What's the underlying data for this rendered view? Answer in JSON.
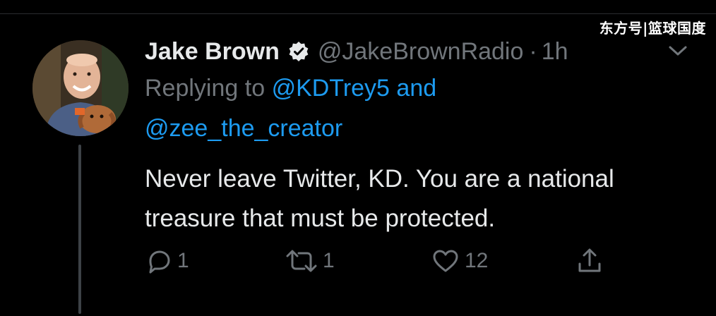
{
  "watermark": "东方号|篮球国度",
  "tweet": {
    "author_name": "Jake Brown",
    "author_handle": "@JakeBrownRadio",
    "separator": "·",
    "time": "1h",
    "replying_prefix": "Replying to",
    "replying_mention_1": "@KDTrey5",
    "replying_and": "and",
    "replying_mention_2": "@zee_the_creator",
    "text": "Never leave Twitter, KD. You are a national treasure that must be protected."
  },
  "actions": {
    "reply_count": "1",
    "retweet_count": "1",
    "like_count": "12"
  },
  "icons": {
    "verified": "verified-badge-icon",
    "more": "chevron-down-icon",
    "reply": "reply-icon",
    "retweet": "retweet-icon",
    "like": "heart-icon",
    "share": "share-icon"
  },
  "colors": {
    "background": "#000000",
    "text": "#e7e9ea",
    "secondary": "#71767b",
    "link": "#1d9bf0"
  }
}
